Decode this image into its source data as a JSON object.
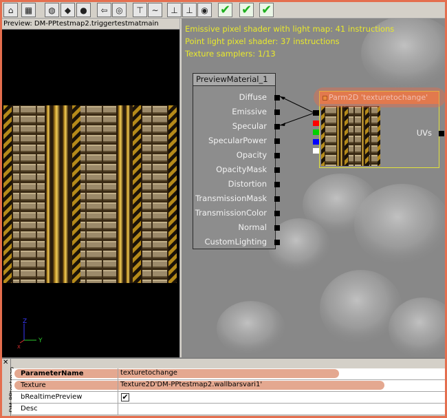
{
  "preview": {
    "title": "Preview: DM-PPtestmap2.triggertestmatmain",
    "axis": {
      "z": "Z",
      "x": "X",
      "y": "Y"
    }
  },
  "stats": [
    "Emissive pixel shader with light map: 41 instructions",
    "Point light pixel shader: 37 instructions",
    "Texture samplers: 1/13"
  ],
  "material_node": {
    "title": "PreviewMaterial_1",
    "inputs": [
      "Diffuse",
      "Emissive",
      "Specular",
      "SpecularPower",
      "Opacity",
      "OpacityMask",
      "Distortion",
      "TransmissionMask",
      "TransmissionColor",
      "Normal",
      "CustomLighting"
    ]
  },
  "param_node": {
    "title": "Parm2D 'texturetochange'",
    "output": "UVs",
    "channel_colors": [
      "#000000",
      "#ff0000",
      "#00d000",
      "#0000ff",
      "#ffffff"
    ]
  },
  "properties": {
    "tab_label": "DM-PPtestmap",
    "close": "✕",
    "rows": [
      {
        "name": "ParameterName",
        "value": "texturetochange"
      },
      {
        "name": "Texture",
        "value": "Texture2D'DM-PPtestmap2.wallbarsvari1'"
      },
      {
        "name": "bRealtimePreview",
        "value": "✔"
      },
      {
        "name": "Desc",
        "value": ""
      }
    ]
  },
  "toolbar": {
    "icons": [
      "home-icon",
      "grid-icon",
      "cylinder-icon",
      "cube-icon",
      "sphere-icon",
      "back-arrow-icon",
      "globe-icon",
      "expose-icon",
      "curve-icon",
      "connector-icon",
      "connector-icon-2",
      "eye-icon",
      "apply-icon",
      "apply-icon-2",
      "apply-icon-3"
    ]
  },
  "colors": {
    "frame": "#e46e4e",
    "highlight": "#e3a38a",
    "stats_text": "#e9e92c",
    "param_title": "#e0814e",
    "param_border": "#e3e33a"
  }
}
